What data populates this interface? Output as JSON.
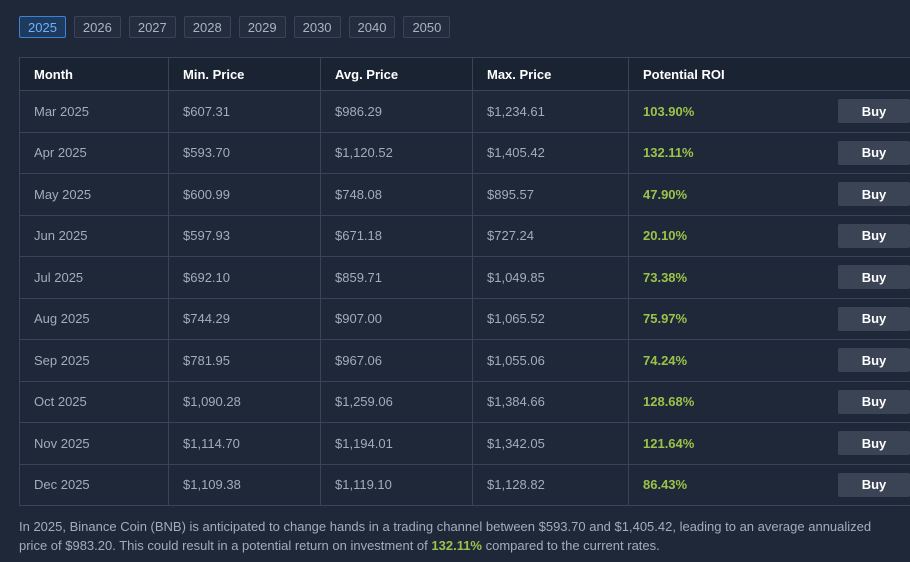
{
  "year_tabs": [
    "2025",
    "2026",
    "2027",
    "2028",
    "2029",
    "2030",
    "2040",
    "2050"
  ],
  "active_tab": "2025",
  "table": {
    "headers": [
      "Month",
      "Min. Price",
      "Avg. Price",
      "Max. Price",
      "Potential ROI"
    ],
    "buy_label": "Buy",
    "rows": [
      {
        "month": "Mar 2025",
        "min": "$607.31",
        "avg": "$986.29",
        "max": "$1,234.61",
        "roi": "103.90%"
      },
      {
        "month": "Apr 2025",
        "min": "$593.70",
        "avg": "$1,120.52",
        "max": "$1,405.42",
        "roi": "132.11%"
      },
      {
        "month": "May 2025",
        "min": "$600.99",
        "avg": "$748.08",
        "max": "$895.57",
        "roi": "47.90%"
      },
      {
        "month": "Jun 2025",
        "min": "$597.93",
        "avg": "$671.18",
        "max": "$727.24",
        "roi": "20.10%"
      },
      {
        "month": "Jul 2025",
        "min": "$692.10",
        "avg": "$859.71",
        "max": "$1,049.85",
        "roi": "73.38%"
      },
      {
        "month": "Aug 2025",
        "min": "$744.29",
        "avg": "$907.00",
        "max": "$1,065.52",
        "roi": "75.97%"
      },
      {
        "month": "Sep 2025",
        "min": "$781.95",
        "avg": "$967.06",
        "max": "$1,055.06",
        "roi": "74.24%"
      },
      {
        "month": "Oct 2025",
        "min": "$1,090.28",
        "avg": "$1,259.06",
        "max": "$1,384.66",
        "roi": "128.68%"
      },
      {
        "month": "Nov 2025",
        "min": "$1,114.70",
        "avg": "$1,194.01",
        "max": "$1,342.05",
        "roi": "121.64%"
      },
      {
        "month": "Dec 2025",
        "min": "$1,109.38",
        "avg": "$1,119.10",
        "max": "$1,128.82",
        "roi": "86.43%"
      }
    ]
  },
  "footer": {
    "text_before": "In 2025, Binance Coin (BNB) is anticipated to change hands in a trading channel between $593.70 and $1,405.42, leading to an average annualized price of $983.20. This could result in a potential return on investment of ",
    "highlight": "132.11%",
    "text_after": " compared to the current rates."
  },
  "colors": {
    "background": "#1f2838",
    "accent": "#3c82d8",
    "roi_green": "#9bc34a",
    "buy_button": "#3a4455"
  }
}
